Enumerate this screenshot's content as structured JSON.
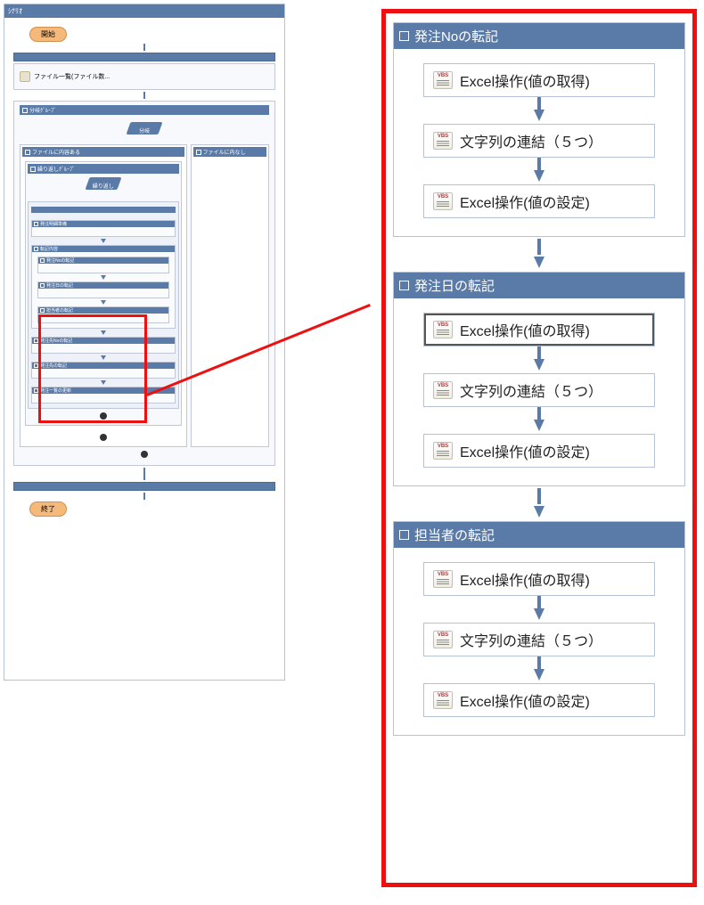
{
  "left": {
    "header": "ｼﾅﾘｵ",
    "start": "開始",
    "end": "終了",
    "file_list": "ファイル一覧(ファイル数...",
    "branch_group": "分岐ｸﾞﾙｰﾌﾟ",
    "branch": "分岐",
    "file_exists": "ファイルに内容ある",
    "file_empty": "ファイルに内なし",
    "loop_group": "繰り返しｸﾞﾙｰﾌﾟ",
    "loop": "繰り返し",
    "subnodes": {
      "a": "発注明細準備",
      "b": "転記内容",
      "c1": "発注Noの転記",
      "c2": "発注日の転記",
      "c3": "担当者の転記",
      "d1": "発注先Noの転記",
      "d2": "発注先の転記",
      "d3": "発注一覧の更新"
    }
  },
  "right": {
    "groups": [
      {
        "title": "発注Noの転記",
        "actions": [
          "Excel操作(値の取得)",
          "文字列の連結（５つ）",
          "Excel操作(値の設定)"
        ],
        "selected_idx": -1
      },
      {
        "title": "発注日の転記",
        "actions": [
          "Excel操作(値の取得)",
          "文字列の連結（５つ）",
          "Excel操作(値の設定)"
        ],
        "selected_idx": 0
      },
      {
        "title": "担当者の転記",
        "actions": [
          "Excel操作(値の取得)",
          "文字列の連結（５つ）",
          "Excel操作(値の設定)"
        ],
        "selected_idx": -1
      }
    ]
  },
  "colors": {
    "accent": "#5a7ba8",
    "highlight": "#ee1010",
    "terminal": "#f5b97c"
  }
}
